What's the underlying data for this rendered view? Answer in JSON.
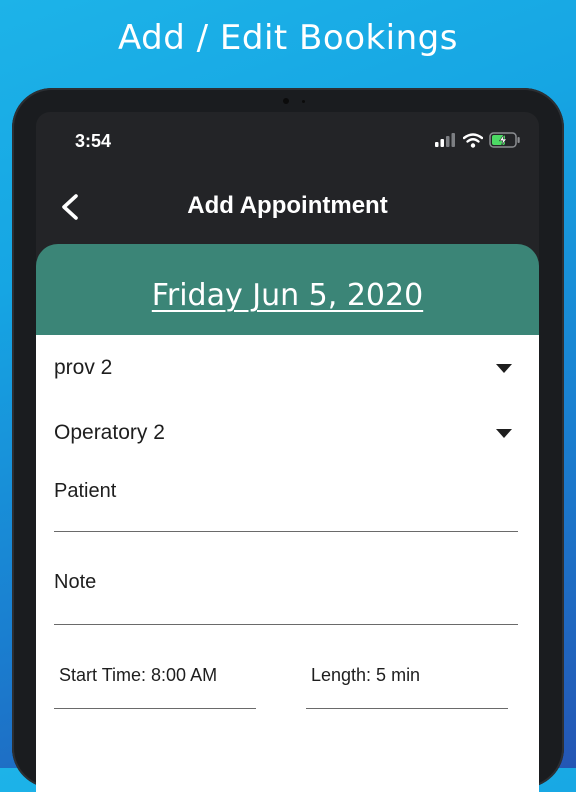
{
  "promo": {
    "title": "Add / Edit Bookings"
  },
  "status_bar": {
    "time": "3:54",
    "icons": [
      "cellular-signal-icon",
      "wifi-icon",
      "battery-charging-icon"
    ],
    "battery_color": "#4cd964"
  },
  "nav": {
    "title": "Add Appointment",
    "back_icon": "chevron-left-icon"
  },
  "date_header": {
    "date": "Friday Jun 5, 2020",
    "background": "#3b8577"
  },
  "form": {
    "provider": {
      "value": "prov 2",
      "icon": "caret-down-icon"
    },
    "operatory": {
      "value": "Operatory 2",
      "icon": "caret-down-icon"
    },
    "patient": {
      "label": "Patient"
    },
    "note": {
      "label": "Note"
    },
    "start_time": {
      "label": "Start Time: 8:00 AM"
    },
    "length": {
      "label": "Length: 5 min"
    }
  }
}
